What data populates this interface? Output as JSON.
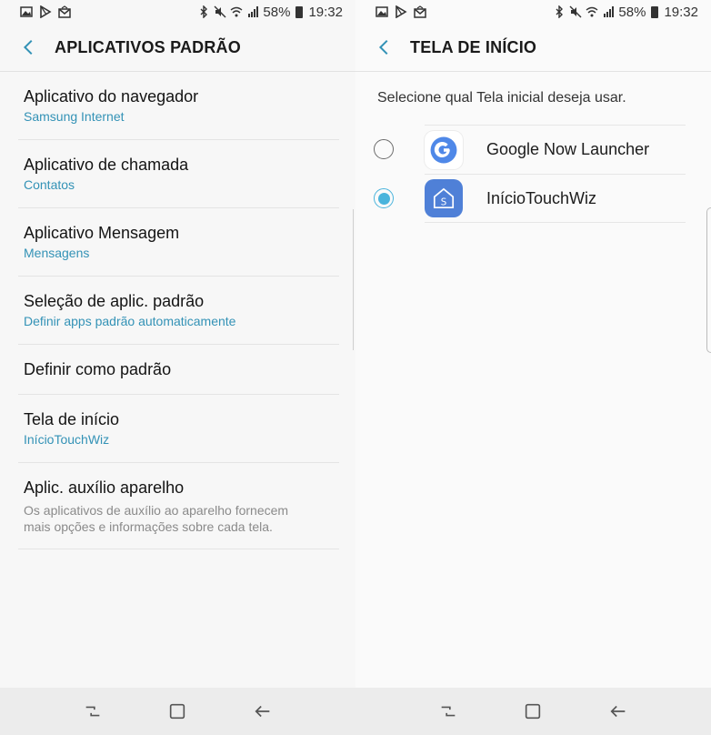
{
  "status_bar": {
    "battery": "58%",
    "time": "19:32",
    "icons": [
      "image-icon",
      "play-store-icon",
      "mail-icon",
      "bluetooth-icon",
      "mute-icon",
      "wifi-icon",
      "signal-icon",
      "battery-icon"
    ]
  },
  "left_screen": {
    "title": "APLICATIVOS PADRÃO",
    "items": [
      {
        "title": "Aplicativo do navegador",
        "sub": "Samsung Internet"
      },
      {
        "title": "Aplicativo de chamada",
        "sub": "Contatos"
      },
      {
        "title": "Aplicativo Mensagem",
        "sub": "Mensagens"
      },
      {
        "title": "Seleção de aplic. padrão",
        "sub": "Definir apps padrão automaticamente"
      },
      {
        "title": "Definir como padrão"
      },
      {
        "title": "Tela de início",
        "sub": "InícioTouchWiz"
      },
      {
        "title": "Aplic. auxílio aparelho",
        "sub": "Os aplicativos de auxílio ao aparelho fornecem mais opções e informações sobre cada tela."
      }
    ]
  },
  "right_screen": {
    "title": "TELA DE INÍCIO",
    "prompt": "Selecione qual Tela inicial deseja usar.",
    "options": [
      {
        "label": "Google Now Launcher",
        "selected": false,
        "icon": "google-icon"
      },
      {
        "label": "InícioTouchWiz",
        "selected": true,
        "icon": "touchwiz-home-icon"
      }
    ]
  },
  "colors": {
    "accent": "#3392b6",
    "radio_selected": "#4ab4dc",
    "touchwiz_icon_bg": "#4f80d7"
  }
}
